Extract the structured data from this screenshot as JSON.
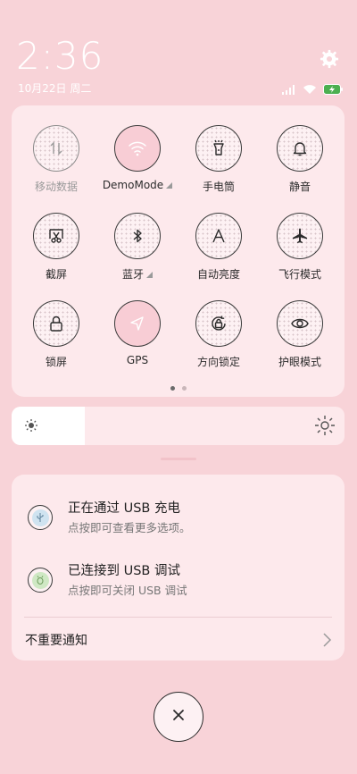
{
  "status_bar": {
    "time": "2:36",
    "date": "10月22日 周二"
  },
  "quick_settings": {
    "tiles": [
      {
        "label": "移动数据",
        "icon": "mobile-data-icon",
        "state": "disabled"
      },
      {
        "label": "DemoMode",
        "icon": "wifi-icon",
        "state": "on",
        "has_menu": true
      },
      {
        "label": "手电筒",
        "icon": "flashlight-icon",
        "state": "off"
      },
      {
        "label": "静音",
        "icon": "bell-icon",
        "state": "off"
      },
      {
        "label": "截屏",
        "icon": "screenshot-icon",
        "state": "off"
      },
      {
        "label": "蓝牙",
        "icon": "bluetooth-icon",
        "state": "off",
        "has_menu": true
      },
      {
        "label": "自动亮度",
        "icon": "auto-brightness-icon",
        "state": "off"
      },
      {
        "label": "飞行模式",
        "icon": "airplane-icon",
        "state": "off"
      },
      {
        "label": "锁屏",
        "icon": "lock-icon",
        "state": "off"
      },
      {
        "label": "GPS",
        "icon": "location-icon",
        "state": "on"
      },
      {
        "label": "方向锁定",
        "icon": "rotation-lock-icon",
        "state": "off"
      },
      {
        "label": "护眼模式",
        "icon": "eye-icon",
        "state": "off"
      }
    ],
    "page_count": 2,
    "active_page": 1
  },
  "brightness": {
    "level": 0.22
  },
  "notifications": {
    "items": [
      {
        "title": "正在通过 USB 充电",
        "subtitle": "点按即可查看更多选项。",
        "icon": "usb-icon",
        "color": "#cfe3f0"
      },
      {
        "title": "已连接到 USB 调试",
        "subtitle": "点按即可关闭 USB 调试",
        "icon": "debug-icon",
        "color": "#cfe8c4"
      }
    ],
    "unimportant_label": "不重要通知"
  },
  "colors": {
    "background": "#f8d3d8",
    "panel": "#fde9ec",
    "tile_on": "#f8cdd5",
    "battery": "#4caf50"
  }
}
